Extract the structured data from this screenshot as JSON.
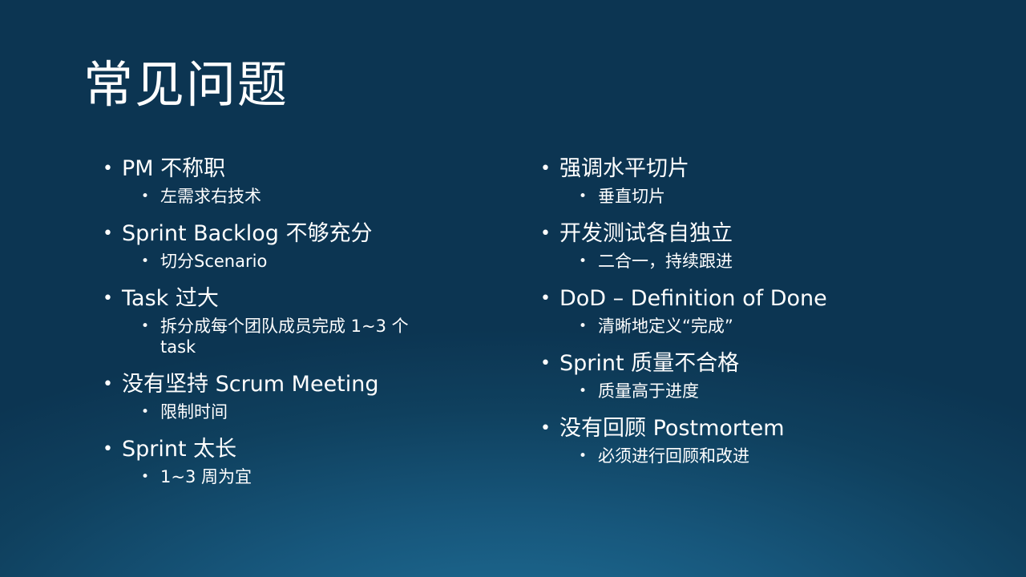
{
  "slide": {
    "title": "常见问题",
    "left_column": [
      {
        "label": "PM 不称职",
        "sub": "左需求右技术"
      },
      {
        "label": "Sprint Backlog 不够充分",
        "sub": "切分Scenario"
      },
      {
        "label": "Task 过大",
        "sub": "拆分成每个团队成员完成 1~3 个 task"
      },
      {
        "label": "没有坚持 Scrum Meeting",
        "sub": "限制时间"
      },
      {
        "label": "Sprint 太长",
        "sub": "1~3 周为宜"
      }
    ],
    "right_column": [
      {
        "label": "强调水平切片",
        "sub": "垂直切片"
      },
      {
        "label": "开发测试各自独立",
        "sub": "二合一，持续跟进"
      },
      {
        "label": "DoD – Definition of Done",
        "sub": "清晰地定义“完成”"
      },
      {
        "label": "Sprint 质量不合格",
        "sub": "质量高于进度"
      },
      {
        "label": "没有回顾 Postmortem",
        "sub": "必须进行回顾和改进"
      }
    ]
  }
}
